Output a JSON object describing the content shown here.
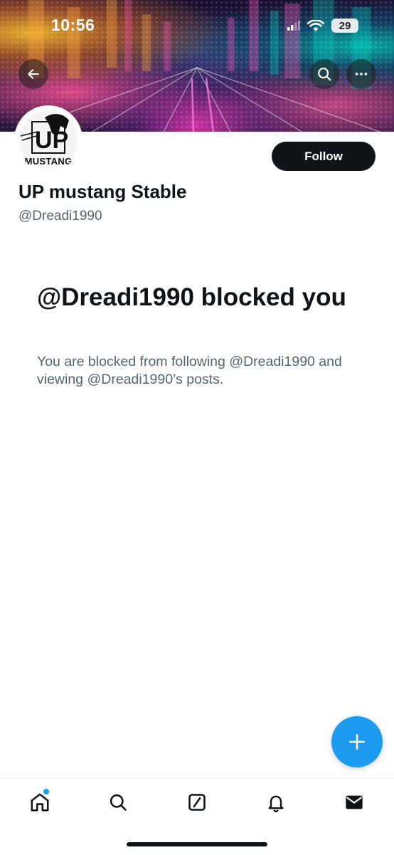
{
  "status_bar": {
    "time": "10:56",
    "battery": "29"
  },
  "header": {
    "back_icon": "arrow-left-icon",
    "search_icon": "search-icon",
    "more_icon": "more-horizontal-icon"
  },
  "profile": {
    "avatar_text": "MUSTANG",
    "display_name": "UP mustang Stable",
    "handle": "@Dreadi1990",
    "follow_label": "Follow"
  },
  "blocked": {
    "title": "@Dreadi1990 blocked you",
    "description": "You are blocked from following @Dreadi1990 and viewing @Dreadi1990’s posts."
  },
  "fab": {
    "icon": "plus-icon"
  },
  "bottom_nav": {
    "items": [
      {
        "icon": "home-icon",
        "has_badge": true
      },
      {
        "icon": "search-icon"
      },
      {
        "icon": "grok-icon"
      },
      {
        "icon": "bell-icon"
      },
      {
        "icon": "mail-icon"
      }
    ]
  },
  "colors": {
    "accent": "#1d9bf0",
    "text_primary": "#0f1419",
    "text_secondary": "#536471"
  }
}
